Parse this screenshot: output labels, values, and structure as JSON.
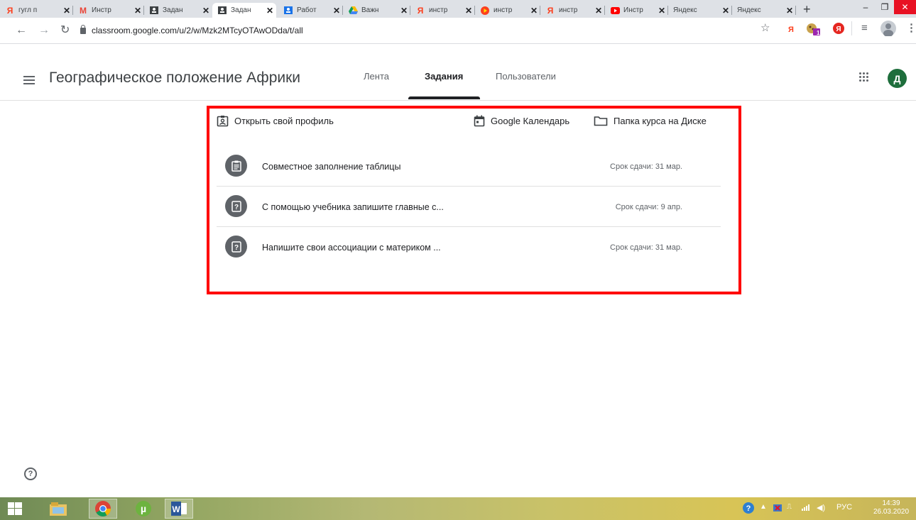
{
  "browser": {
    "tabs": [
      {
        "title": "гугл п",
        "icon": "yandex",
        "active": false
      },
      {
        "title": "Инстр",
        "icon": "gmail",
        "active": false
      },
      {
        "title": "Задан",
        "icon": "classroom",
        "active": false
      },
      {
        "title": "Задан",
        "icon": "classroom",
        "active": true
      },
      {
        "title": "Работ",
        "icon": "classroom-blue",
        "active": false
      },
      {
        "title": "Важн",
        "icon": "drive",
        "active": false
      },
      {
        "title": "инстр",
        "icon": "yandex",
        "active": false
      },
      {
        "title": "инстр",
        "icon": "yandex-video",
        "active": false
      },
      {
        "title": "инстр",
        "icon": "yandex",
        "active": false
      },
      {
        "title": "Инстр",
        "icon": "youtube",
        "active": false
      },
      {
        "title": "Яндекс",
        "icon": "none",
        "active": false
      },
      {
        "title": "Яндекс",
        "icon": "none",
        "active": false
      }
    ],
    "new_tab": "+",
    "url": "classroom.google.com/u/2/w/Mzk2MTcyOTAwODda/t/all",
    "ext_badge": "1"
  },
  "classroom": {
    "course_title": "Географическое положение Африки",
    "tabs": [
      {
        "label": "Лента",
        "active": false
      },
      {
        "label": "Задания",
        "active": true
      },
      {
        "label": "Пользователи",
        "active": false
      }
    ],
    "avatar_letter": "Д"
  },
  "links": {
    "profile": "Открыть свой профиль",
    "calendar": "Google Календарь",
    "drive_folder": "Папка курса на Диске"
  },
  "work_items": [
    {
      "title": "Совместное заполнение таблицы",
      "due": "Срок сдачи: 31 мар.",
      "icon": "assignment-icon"
    },
    {
      "title": "С помощью учебника запишите главные с...",
      "due": "Срок сдачи: 9 апр.",
      "icon": "question-icon"
    },
    {
      "title": "Напишите свои ассоциации с материком ...",
      "due": "Срок сдачи: 31 мар.",
      "icon": "question-icon"
    }
  ],
  "taskbar": {
    "language": "РУС",
    "time": "14:39",
    "date": "26.03.2020"
  },
  "colors": {
    "highlight": "#ff0000",
    "avatar": "#1e6e3c",
    "icon_gray": "#5f6368"
  }
}
